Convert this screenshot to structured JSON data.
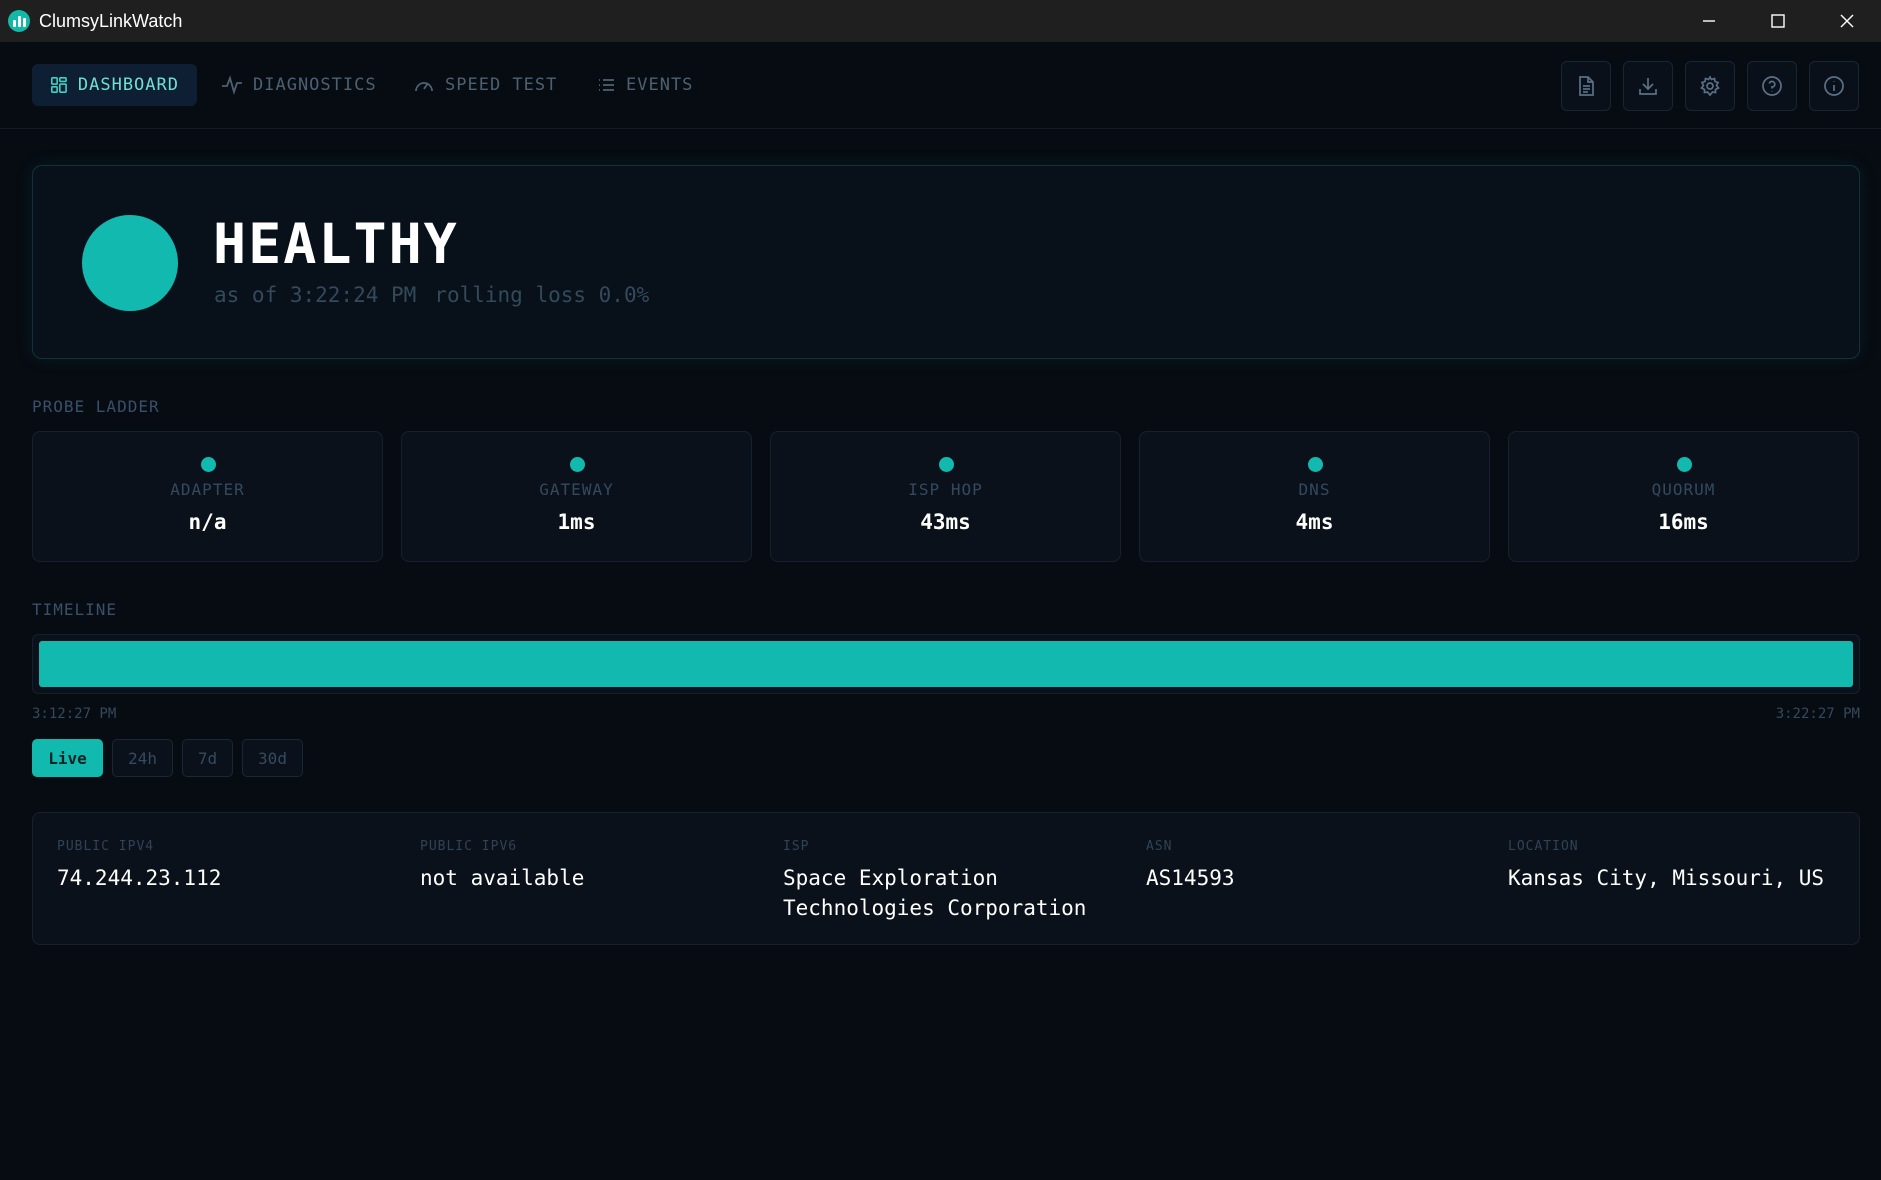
{
  "window": {
    "title": "ClumsyLinkWatch",
    "icon": "bar-chart-icon"
  },
  "nav": {
    "tabs": [
      {
        "label": "DASHBOARD",
        "icon": "grid-icon",
        "active": true
      },
      {
        "label": "DIAGNOSTICS",
        "icon": "pulse-icon",
        "active": false
      },
      {
        "label": "SPEED TEST",
        "icon": "gauge-icon",
        "active": false
      },
      {
        "label": "EVENTS",
        "icon": "list-icon",
        "active": false
      }
    ],
    "tools": [
      "report-icon",
      "download-icon",
      "settings-icon",
      "help-icon",
      "info-icon"
    ]
  },
  "status": {
    "title": "HEALTHY",
    "as_of": "as of 3:22:24 PM",
    "loss": "rolling loss 0.0%",
    "color": "#11b9ae"
  },
  "probe_ladder": {
    "label": "PROBE LADDER",
    "probes": [
      {
        "name": "ADAPTER",
        "value": "n/a"
      },
      {
        "name": "GATEWAY",
        "value": "1ms"
      },
      {
        "name": "ISP HOP",
        "value": "43ms"
      },
      {
        "name": "DNS",
        "value": "4ms"
      },
      {
        "name": "QUORUM",
        "value": "16ms"
      }
    ]
  },
  "timeline": {
    "label": "TIMELINE",
    "start": "3:12:27 PM",
    "end": "3:22:27 PM",
    "healthy_fraction": 1.0,
    "ranges": [
      {
        "label": "Live",
        "active": true
      },
      {
        "label": "24h",
        "active": false
      },
      {
        "label": "7d",
        "active": false
      },
      {
        "label": "30d",
        "active": false
      }
    ]
  },
  "network_info": {
    "public_ipv4": {
      "label": "PUBLIC IPV4",
      "value": "74.244.23.112"
    },
    "public_ipv6": {
      "label": "PUBLIC IPV6",
      "value": "not available"
    },
    "isp": {
      "label": "ISP",
      "value": "Space Exploration Technologies Corporation"
    },
    "asn": {
      "label": "ASN",
      "value": "AS14593"
    },
    "location": {
      "label": "LOCATION",
      "value": "Kansas City, Missouri, US"
    }
  },
  "colors": {
    "accent": "#11b9ae",
    "background": "#070b12"
  }
}
